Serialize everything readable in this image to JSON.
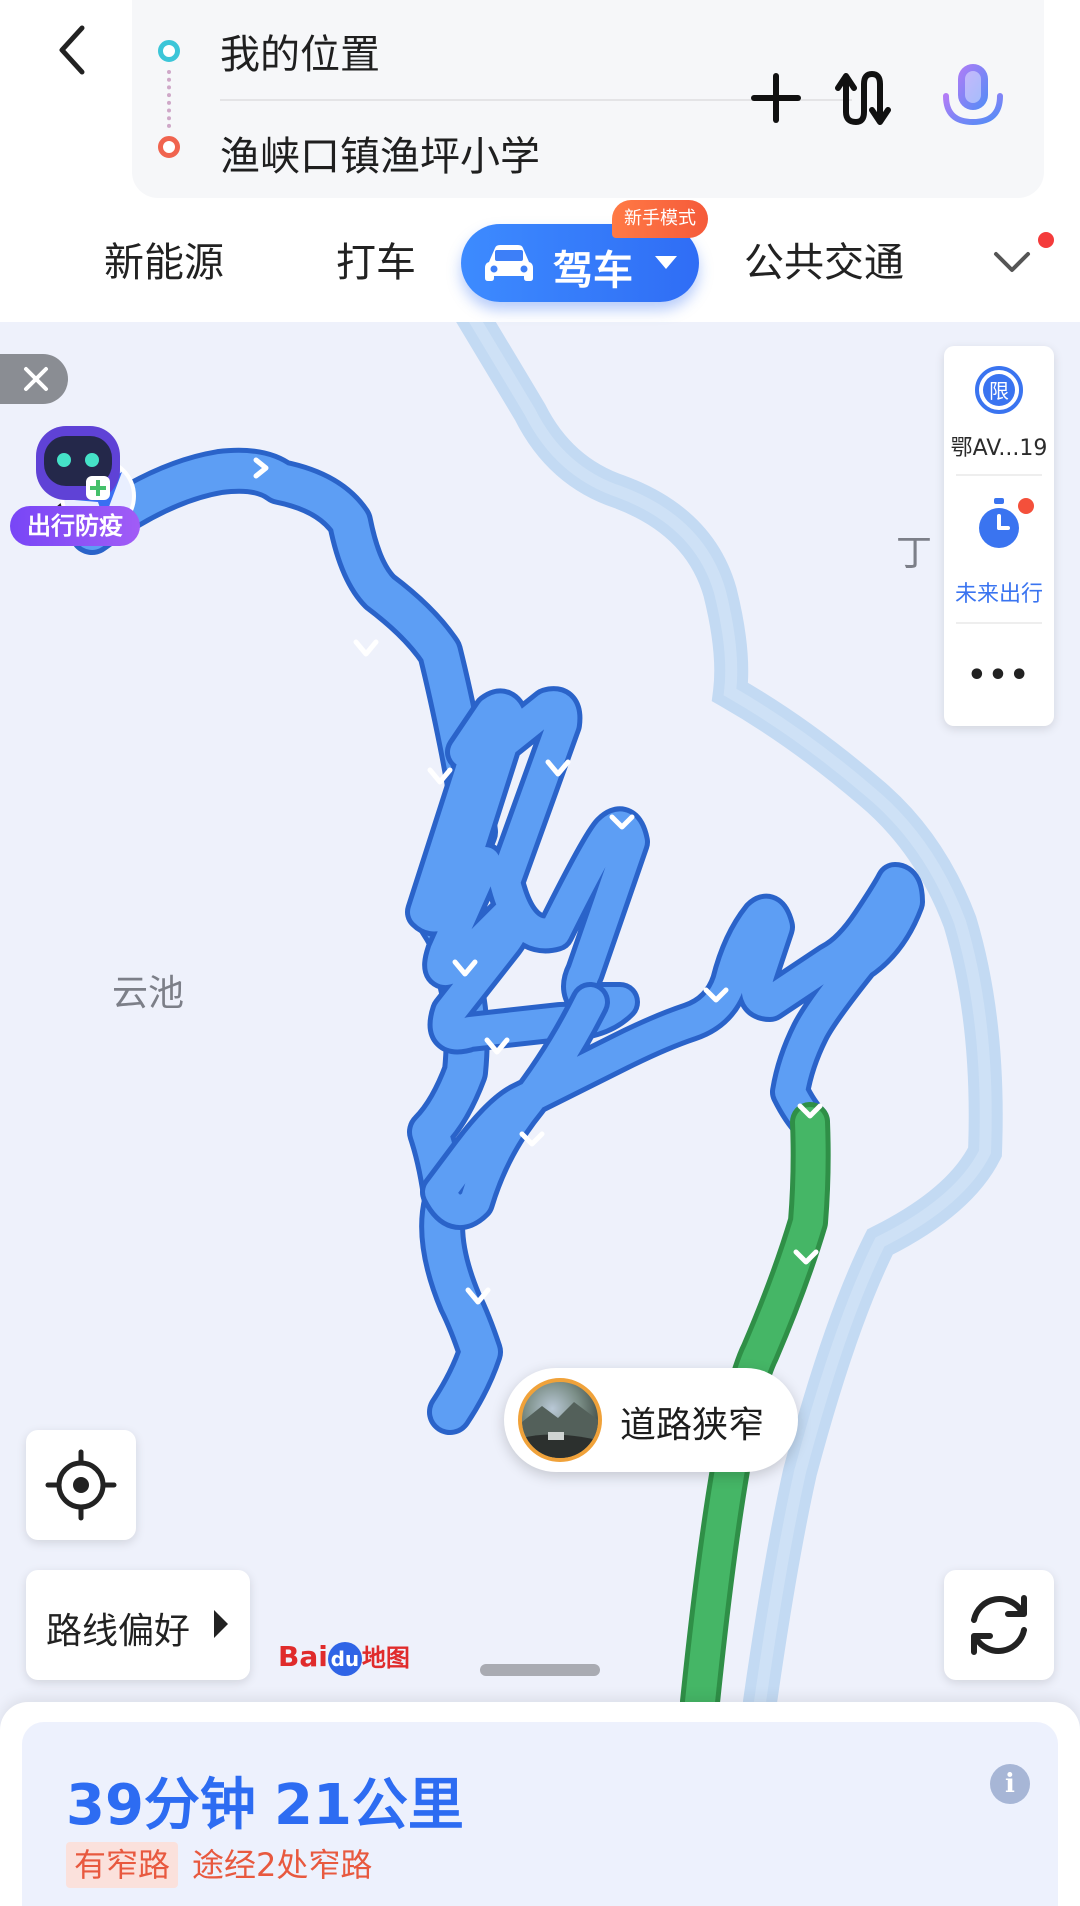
{
  "search": {
    "start_label": "我的位置",
    "end_label": "渔峡口镇渔坪小学"
  },
  "tabs": [
    {
      "label": "新能源"
    },
    {
      "label": "打车"
    },
    {
      "label": "驾车",
      "active": true
    },
    {
      "label": "公共交通"
    }
  ],
  "newbie_badge": "新手模式",
  "epidemic_widget": {
    "label": "出行防疫"
  },
  "side_panel": {
    "restriction": {
      "icon_text": "限",
      "label": "鄂AV...19"
    },
    "future_trip": {
      "label": "未来出行"
    },
    "more": {
      "label": "•••"
    }
  },
  "map": {
    "labels": {
      "yunchi": "云池",
      "partial_ding": "丁"
    },
    "callout": {
      "text": "道路狭窄"
    },
    "logo": {
      "bai": "Bai",
      "du": "du",
      "map": "地图"
    }
  },
  "route_pref": {
    "label": "路线偏好"
  },
  "route_summary": {
    "time": "39分钟",
    "distance": "21公里",
    "narrow_tag": "有窄路",
    "narrow_desc": "途经2处窄路"
  },
  "colors": {
    "accent": "#2d6cf2",
    "route_blue": "#5b9cf2",
    "route_green": "#3fb35e",
    "river": "#c0d8f2",
    "warning": "#e8593f"
  }
}
